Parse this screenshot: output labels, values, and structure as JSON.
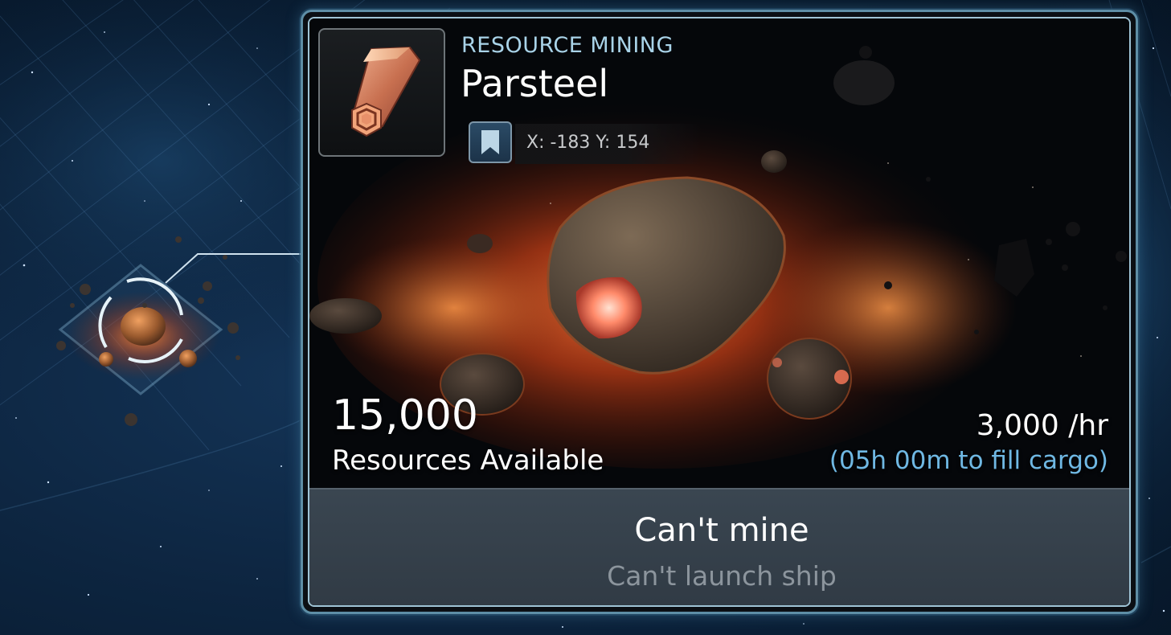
{
  "panel": {
    "category": "RESOURCE MINING",
    "resource_name": "Parsteel",
    "coordinates": "X: -183 Y: 154",
    "resources_amount": "15,000",
    "resources_label": "Resources Available",
    "mining_rate": "3,000 /hr",
    "fill_time": "(05h 00m to fill cargo)",
    "action_title": "Can't mine",
    "action_subtitle": "Can't launch ship"
  },
  "icons": {
    "resource": "parsteel-ingot-icon",
    "bookmark": "bookmark-icon"
  },
  "colors": {
    "panel_border": "#5e8ea6",
    "category_text": "#a9d3e8",
    "fill_time_text": "#6fb8e3",
    "action_background": "#36424d"
  }
}
